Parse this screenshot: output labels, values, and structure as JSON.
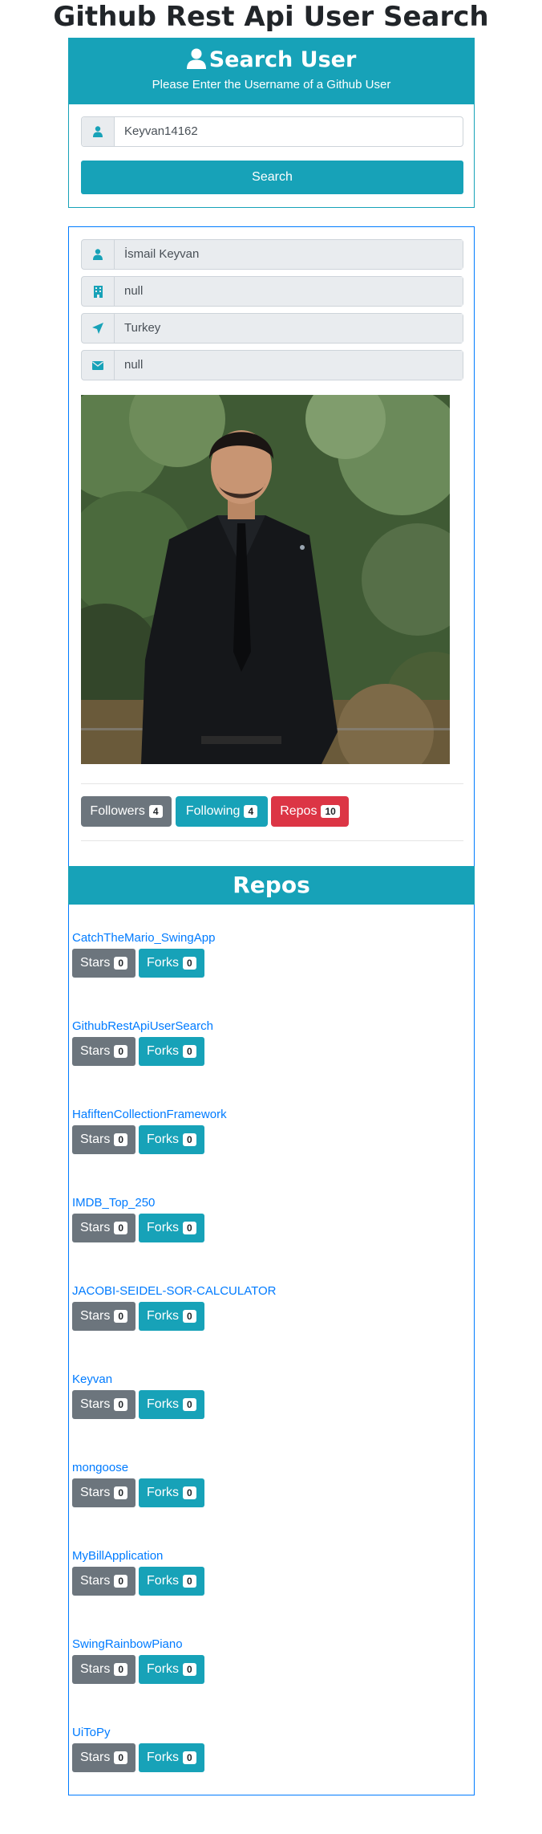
{
  "page_title": "Github Rest Api User Search",
  "search": {
    "title": "Search User",
    "subtitle": "Please Enter the Username of a Github User",
    "username_value": "Keyvan14162",
    "button_label": "Search"
  },
  "profile": {
    "name": "İsmail Keyvan",
    "company": "null",
    "location": "Turkey",
    "email": "null",
    "followers_label": "Followers",
    "followers_count": "4",
    "following_label": "Following",
    "following_count": "4",
    "repos_label": "Repos",
    "repos_count": "10"
  },
  "repos_title": "Repos",
  "repos": [
    {
      "name": "CatchTheMario_SwingApp",
      "stars_label": "Stars",
      "stars": "0",
      "forks_label": "Forks",
      "forks": "0"
    },
    {
      "name": "GithubRestApiUserSearch",
      "stars_label": "Stars",
      "stars": "0",
      "forks_label": "Forks",
      "forks": "0"
    },
    {
      "name": "HafiftenCollectionFramework",
      "stars_label": "Stars",
      "stars": "0",
      "forks_label": "Forks",
      "forks": "0"
    },
    {
      "name": "IMDB_Top_250",
      "stars_label": "Stars",
      "stars": "0",
      "forks_label": "Forks",
      "forks": "0"
    },
    {
      "name": "JACOBI-SEIDEL-SOR-CALCULATOR",
      "stars_label": "Stars",
      "stars": "0",
      "forks_label": "Forks",
      "forks": "0"
    },
    {
      "name": "Keyvan",
      "stars_label": "Stars",
      "stars": "0",
      "forks_label": "Forks",
      "forks": "0"
    },
    {
      "name": "mongoose",
      "stars_label": "Stars",
      "stars": "0",
      "forks_label": "Forks",
      "forks": "0"
    },
    {
      "name": "MyBillApplication",
      "stars_label": "Stars",
      "stars": "0",
      "forks_label": "Forks",
      "forks": "0"
    },
    {
      "name": "SwingRainbowPiano",
      "stars_label": "Stars",
      "stars": "0",
      "forks_label": "Forks",
      "forks": "0"
    },
    {
      "name": "UiToPy",
      "stars_label": "Stars",
      "stars": "0",
      "forks_label": "Forks",
      "forks": "0"
    }
  ],
  "colors": {
    "teal": "#17a2b8",
    "gray": "#6c757d",
    "red": "#dc3545",
    "link": "#007bff"
  },
  "icons": {
    "title_icon": "user-icon",
    "username_icon": "user-icon",
    "name_icon": "user-icon",
    "company_icon": "building-icon",
    "location_icon": "location-arrow-icon",
    "email_icon": "envelope-icon"
  }
}
